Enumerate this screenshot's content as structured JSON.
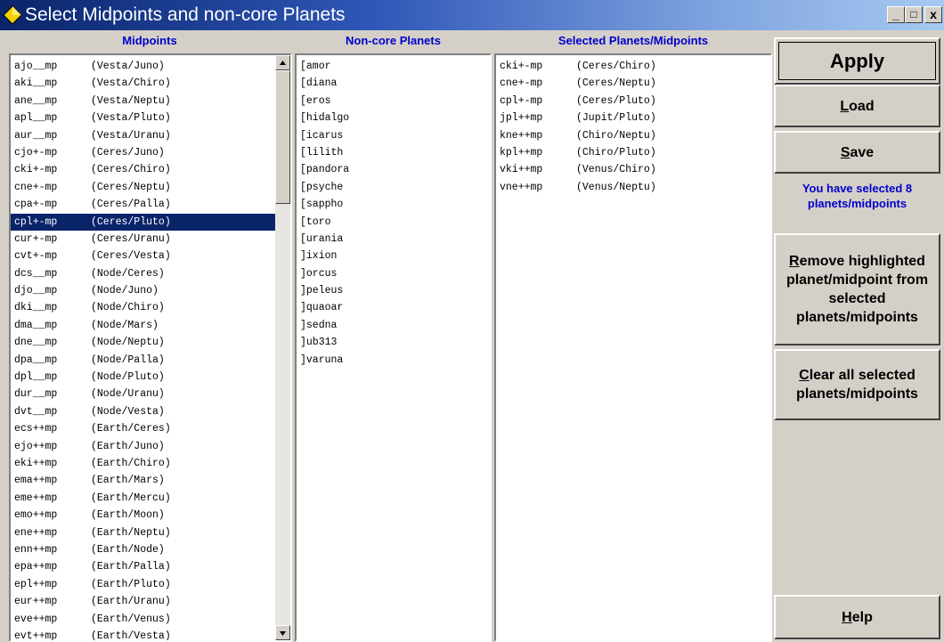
{
  "window": {
    "title": "Select Midpoints and non-core Planets",
    "min": "_",
    "max": "□",
    "close": "x"
  },
  "headers": {
    "midpoints": "Midpoints",
    "noncore": "Non-core Planets",
    "selected": "Selected Planets/Midpoints"
  },
  "midpoints": [
    {
      "code": "ajo__mp",
      "name": "(Vesta/Juno)"
    },
    {
      "code": "aki__mp",
      "name": "(Vesta/Chiro)"
    },
    {
      "code": "ane__mp",
      "name": "(Vesta/Neptu)"
    },
    {
      "code": "apl__mp",
      "name": "(Vesta/Pluto)"
    },
    {
      "code": "aur__mp",
      "name": "(Vesta/Uranu)"
    },
    {
      "code": "cjo+-mp",
      "name": "(Ceres/Juno)"
    },
    {
      "code": "cki+-mp",
      "name": "(Ceres/Chiro)"
    },
    {
      "code": "cne+-mp",
      "name": "(Ceres/Neptu)"
    },
    {
      "code": "cpa+-mp",
      "name": "(Ceres/Palla)"
    },
    {
      "code": "cpl+-mp",
      "name": "(Ceres/Pluto)"
    },
    {
      "code": "cur+-mp",
      "name": "(Ceres/Uranu)"
    },
    {
      "code": "cvt+-mp",
      "name": "(Ceres/Vesta)"
    },
    {
      "code": "dcs__mp",
      "name": "(Node/Ceres)"
    },
    {
      "code": "djo__mp",
      "name": "(Node/Juno)"
    },
    {
      "code": "dki__mp",
      "name": "(Node/Chiro)"
    },
    {
      "code": "dma__mp",
      "name": "(Node/Mars)"
    },
    {
      "code": "dne__mp",
      "name": "(Node/Neptu)"
    },
    {
      "code": "dpa__mp",
      "name": "(Node/Palla)"
    },
    {
      "code": "dpl__mp",
      "name": "(Node/Pluto)"
    },
    {
      "code": "dur__mp",
      "name": "(Node/Uranu)"
    },
    {
      "code": "dvt__mp",
      "name": "(Node/Vesta)"
    },
    {
      "code": "ecs++mp",
      "name": "(Earth/Ceres)"
    },
    {
      "code": "ejo++mp",
      "name": "(Earth/Juno)"
    },
    {
      "code": "eki++mp",
      "name": "(Earth/Chiro)"
    },
    {
      "code": "ema++mp",
      "name": "(Earth/Mars)"
    },
    {
      "code": "eme++mp",
      "name": "(Earth/Mercu)"
    },
    {
      "code": "emo++mp",
      "name": "(Earth/Moon)"
    },
    {
      "code": "ene++mp",
      "name": "(Earth/Neptu)"
    },
    {
      "code": "enn++mp",
      "name": "(Earth/Node)"
    },
    {
      "code": "epa++mp",
      "name": "(Earth/Palla)"
    },
    {
      "code": "epl++mp",
      "name": "(Earth/Pluto)"
    },
    {
      "code": "eur++mp",
      "name": "(Earth/Uranu)"
    },
    {
      "code": "eve++mp",
      "name": "(Earth/Venus)"
    },
    {
      "code": "evt++mp",
      "name": "(Earth/Vesta)"
    }
  ],
  "selected_midpoint_index": 9,
  "noncore": [
    "[amor",
    "[diana",
    "[eros",
    "[hidalgo",
    "[icarus",
    "[lilith",
    "[pandora",
    "[psyche",
    "[sappho",
    "[toro",
    "[urania",
    "]ixion",
    "]orcus",
    "]peleus",
    "]quaoar",
    "]sedna",
    "]ub313",
    "]varuna"
  ],
  "selected": [
    {
      "code": "cki+-mp",
      "name": "(Ceres/Chiro)"
    },
    {
      "code": "cne+-mp",
      "name": "(Ceres/Neptu)"
    },
    {
      "code": "cpl+-mp",
      "name": "(Ceres/Pluto)"
    },
    {
      "code": "jpl++mp",
      "name": "(Jupit/Pluto)"
    },
    {
      "code": "kne++mp",
      "name": "(Chiro/Neptu)"
    },
    {
      "code": "kpl++mp",
      "name": "(Chiro/Pluto)"
    },
    {
      "code": "vki++mp",
      "name": "(Venus/Chiro)"
    },
    {
      "code": "vne++mp",
      "name": "(Venus/Neptu)"
    }
  ],
  "buttons": {
    "apply": "Apply",
    "load": "Load",
    "save": "Save",
    "remove": "Remove highlighted planet/midpoint from selected planets/midpoints",
    "clear": "Clear all selected planets/midpoints",
    "help": "Help"
  },
  "info": "You have selected 8 planets/midpoints",
  "colors": {
    "title_start": "#0a246a",
    "highlight": "#0a246a",
    "header_text": "#0000cc",
    "face": "#d4d0c8"
  }
}
